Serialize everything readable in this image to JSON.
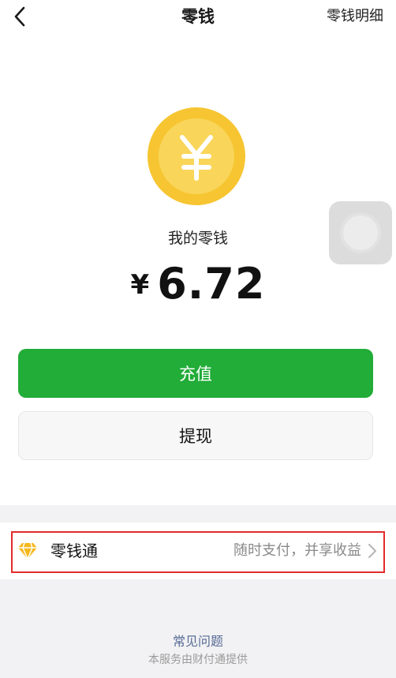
{
  "nav": {
    "title": "零钱",
    "detail_label": "零钱明细"
  },
  "balance": {
    "label": "我的零钱",
    "currency": "¥",
    "amount": "6.72"
  },
  "actions": {
    "recharge_label": "充值",
    "withdraw_label": "提现"
  },
  "lingqiantong": {
    "name": "零钱通",
    "description": "随时支付，并享收益"
  },
  "footer": {
    "faq_label": "常见问题",
    "provider_text": "本服务由财付通提供"
  },
  "colors": {
    "primary_green": "#22ac38",
    "coin_yellow": "#f6c531",
    "highlight_red": "#e32b2b",
    "link_blue": "#576b95"
  },
  "icons": {
    "back": "chevron-left-icon",
    "coin": "yen-coin-icon",
    "gem": "diamond-icon",
    "arrow": "chevron-right-icon"
  }
}
